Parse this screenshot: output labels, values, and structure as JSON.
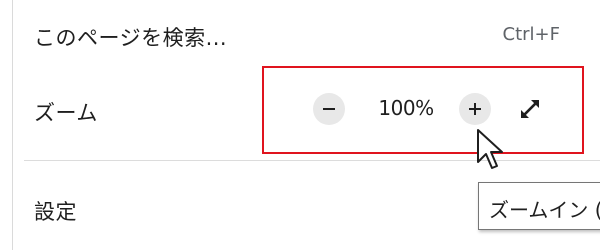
{
  "menu": {
    "find": {
      "label": "このページを検索...",
      "shortcut": "Ctrl+F"
    },
    "zoom": {
      "label": "ズーム",
      "value": "100%",
      "zoom_out_icon": "minus-icon",
      "zoom_in_icon": "plus-icon",
      "fullscreen_icon": "fullscreen-icon"
    },
    "settings": {
      "label": "設定"
    }
  },
  "tooltip": {
    "text": "ズームイン ("
  },
  "colors": {
    "highlight": "#e0141e",
    "button_bg": "#e8e8e8",
    "text": "#1f1f1f",
    "shortcut_text": "#5f6368"
  }
}
